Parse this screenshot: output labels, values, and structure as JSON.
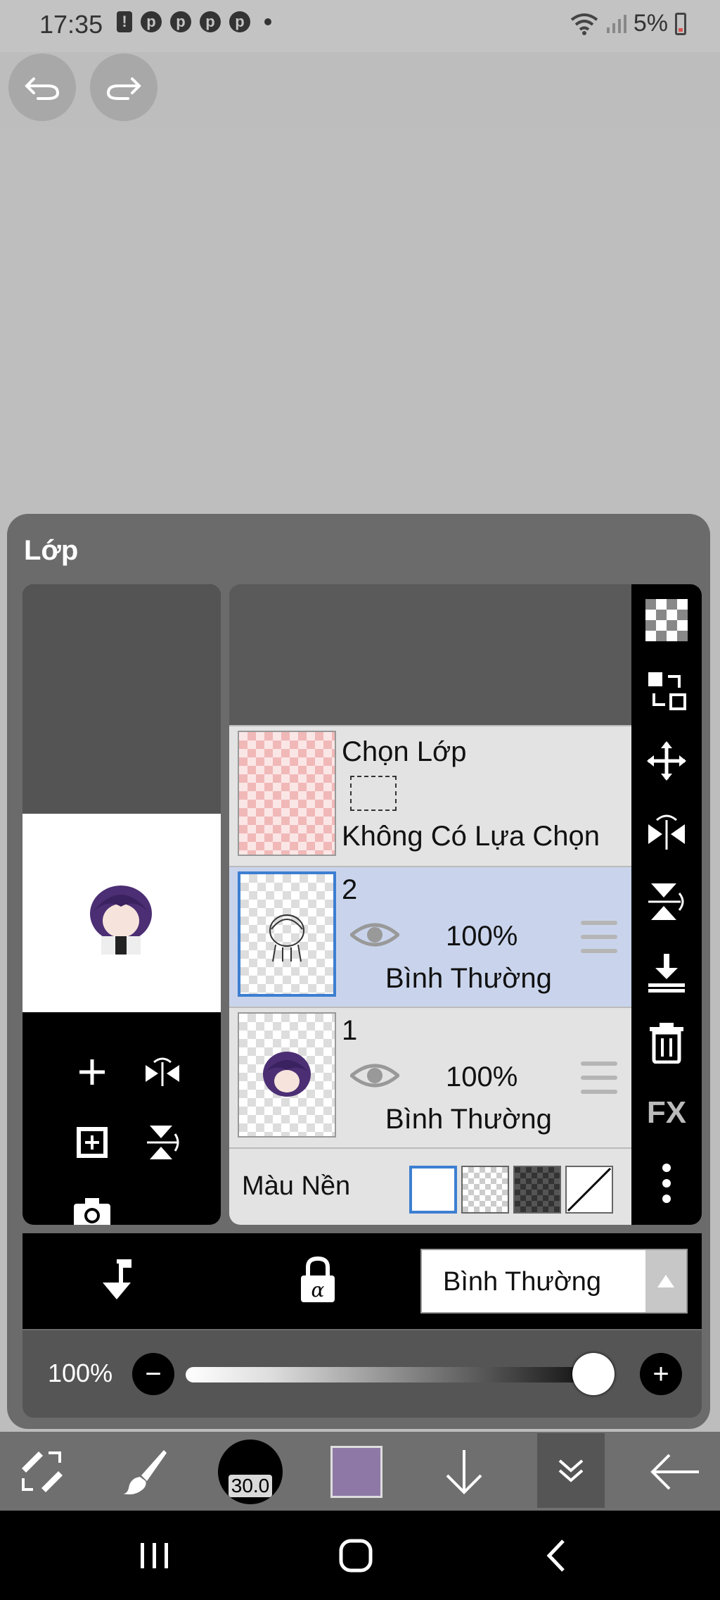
{
  "status_bar": {
    "time": "17:35",
    "battery": "5%",
    "notification_icons": [
      "alert-icon",
      "pinterest-icon",
      "pinterest-icon",
      "pinterest-icon",
      "pinterest-icon",
      "more-dot-icon"
    ],
    "system_icons": [
      "wifi-icon",
      "signal-icon",
      "battery-icon"
    ]
  },
  "canvas": {
    "background": "#bebebe"
  },
  "layer_panel": {
    "title": "Lớp",
    "selection_layer": {
      "title": "Chọn Lớp",
      "status": "Không Có Lựa Chọn"
    },
    "layers": [
      {
        "name": "2",
        "opacity": "100%",
        "blend_mode": "Bình Thường",
        "visible": true,
        "selected": true
      },
      {
        "name": "1",
        "opacity": "100%",
        "blend_mode": "Bình Thường",
        "visible": true,
        "selected": false
      }
    ],
    "background_color": {
      "label": "Màu Nền",
      "options": [
        "white",
        "transparent",
        "dark-checker",
        "none"
      ],
      "selected": "white"
    },
    "side_tools": [
      "checker-icon",
      "swap-layer-icon",
      "move-icon",
      "flip-horizontal-icon",
      "flip-vertical-icon",
      "merge-down-icon",
      "trash-icon",
      "fx-label",
      "more-vert-icon"
    ],
    "fx_label": "FX",
    "preview_tools": [
      "add-layer-icon",
      "flip-horizontal-icon",
      "add-copy-icon",
      "flip-vertical-icon",
      "camera-icon"
    ],
    "blend_mode_select": "Bình Thường",
    "opacity": {
      "label": "100%",
      "value": 100,
      "minus": "−",
      "plus": "+"
    }
  },
  "bottom_toolbar": {
    "brush_size": "30.0",
    "current_color": "#8e79a6",
    "items": [
      "transform-icon",
      "brush-icon",
      "brush-size",
      "color-swatch",
      "arrow-down-icon",
      "double-chevron-down-icon",
      "arrow-left-icon"
    ]
  },
  "nav_bar": [
    "recents-icon",
    "home-icon",
    "back-icon"
  ],
  "colors": {
    "selected_row": "#c9d4ec",
    "selected_border": "#3d7fd1",
    "panel": "#6b6b6b",
    "accent_purple": "#8e79a6"
  }
}
